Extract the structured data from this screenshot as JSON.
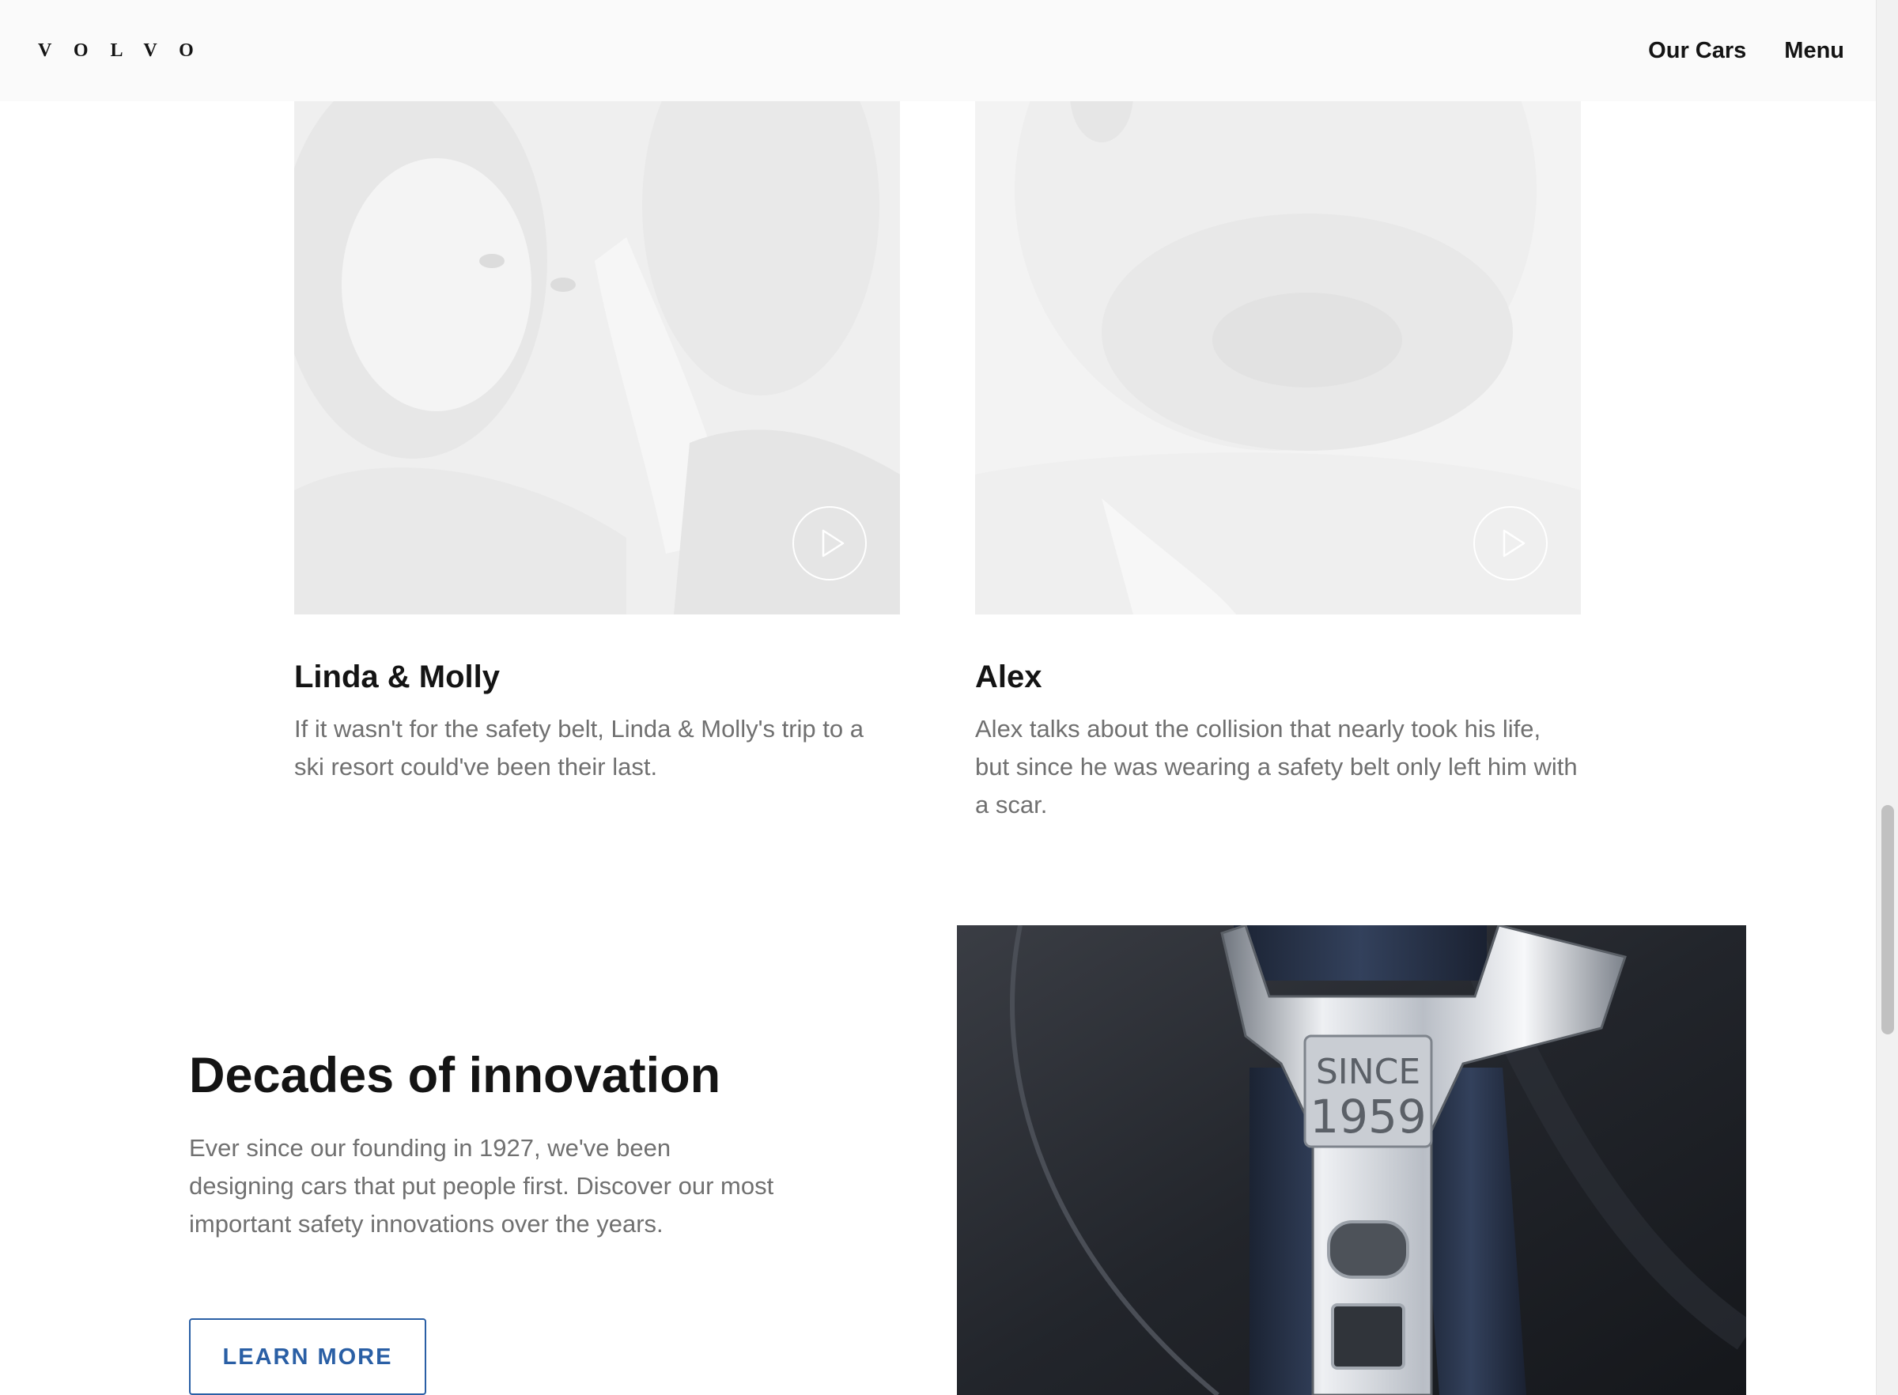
{
  "header": {
    "logo": "VOLVO",
    "nav": [
      {
        "label": "Our Cars"
      },
      {
        "label": "Menu"
      }
    ]
  },
  "stories": [
    {
      "title": "Linda & Molly",
      "description": "If it wasn't for the safety belt, Linda & Molly's trip to a ski resort could've been their last.",
      "icon": "play-icon"
    },
    {
      "title": "Alex",
      "description": "Alex talks about the collision that nearly took his life, but since he was wearing a safety belt only left him with a scar.",
      "icon": "play-icon"
    }
  ],
  "innovation": {
    "title": "Decades of innovation",
    "text": "Ever since our founding in 1927, we've been designing cars that put people first. Discover our most important safety innovations over the years.",
    "button_label": "LEARN MORE",
    "image_text_line1": "SINCE",
    "image_text_line2": "1959"
  },
  "colors": {
    "accent": "#2a5fa5",
    "body_text": "#707070",
    "heading_text": "#141414",
    "header_bg": "#fafafa",
    "image_placeholder": "#f2f2f2"
  }
}
